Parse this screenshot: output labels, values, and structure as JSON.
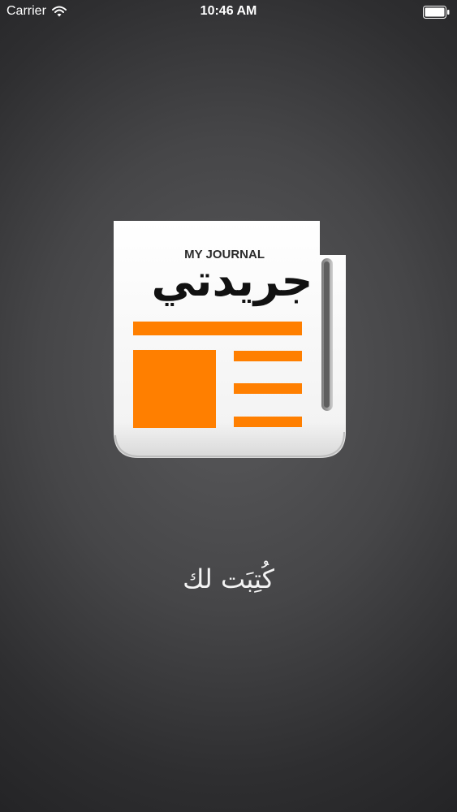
{
  "status_bar": {
    "carrier": "Carrier",
    "time": "10:46 AM",
    "wifi_icon": "wifi-icon",
    "battery_icon": "battery-full-icon"
  },
  "logo": {
    "brand_en": "MY JOURNAL",
    "brand_ar": "جريدتي",
    "accent_color": "#ff7f00",
    "paper_color": "#ffffff"
  },
  "tagline": "كُتِبَت لك"
}
